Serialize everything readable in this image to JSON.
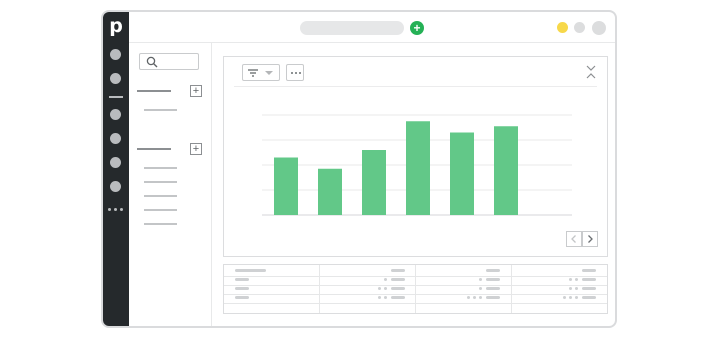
{
  "app": {
    "logo_text": "p",
    "colors": {
      "rail": "#25292c",
      "accent_green": "#25b156",
      "bar_green": "#62c888",
      "dot_yellow": "#f7d84a",
      "dot_grey": "#dcddde"
    }
  },
  "rail": {
    "icons": [
      "nav-dot-icon",
      "nav-dot-icon",
      "divider",
      "nav-dot-icon",
      "nav-dot-icon",
      "nav-dot-icon",
      "nav-dot-icon",
      "more-dots-icon"
    ]
  },
  "topbar": {
    "add_button_label": "+",
    "window_dots": [
      "yellow",
      "grey",
      "grey"
    ]
  },
  "sidebar": {
    "search_icon": "search-icon",
    "sections": [
      {
        "add_label": "+",
        "items": 1
      },
      {
        "add_label": "+",
        "items": 5
      }
    ]
  },
  "card": {
    "filter_icon": "filter-icon",
    "more_icon": "more-dots-icon",
    "collapse_icon": "collapse-icon"
  },
  "chart_data": {
    "type": "bar",
    "categories": [
      "",
      "",
      "",
      "",
      "",
      ""
    ],
    "values": [
      2.3,
      1.85,
      2.6,
      3.75,
      3.3,
      3.55
    ],
    "ylim": [
      0,
      4
    ],
    "grid": true,
    "color": "#62c888"
  },
  "table": {
    "columns": 4,
    "rows": 3
  }
}
